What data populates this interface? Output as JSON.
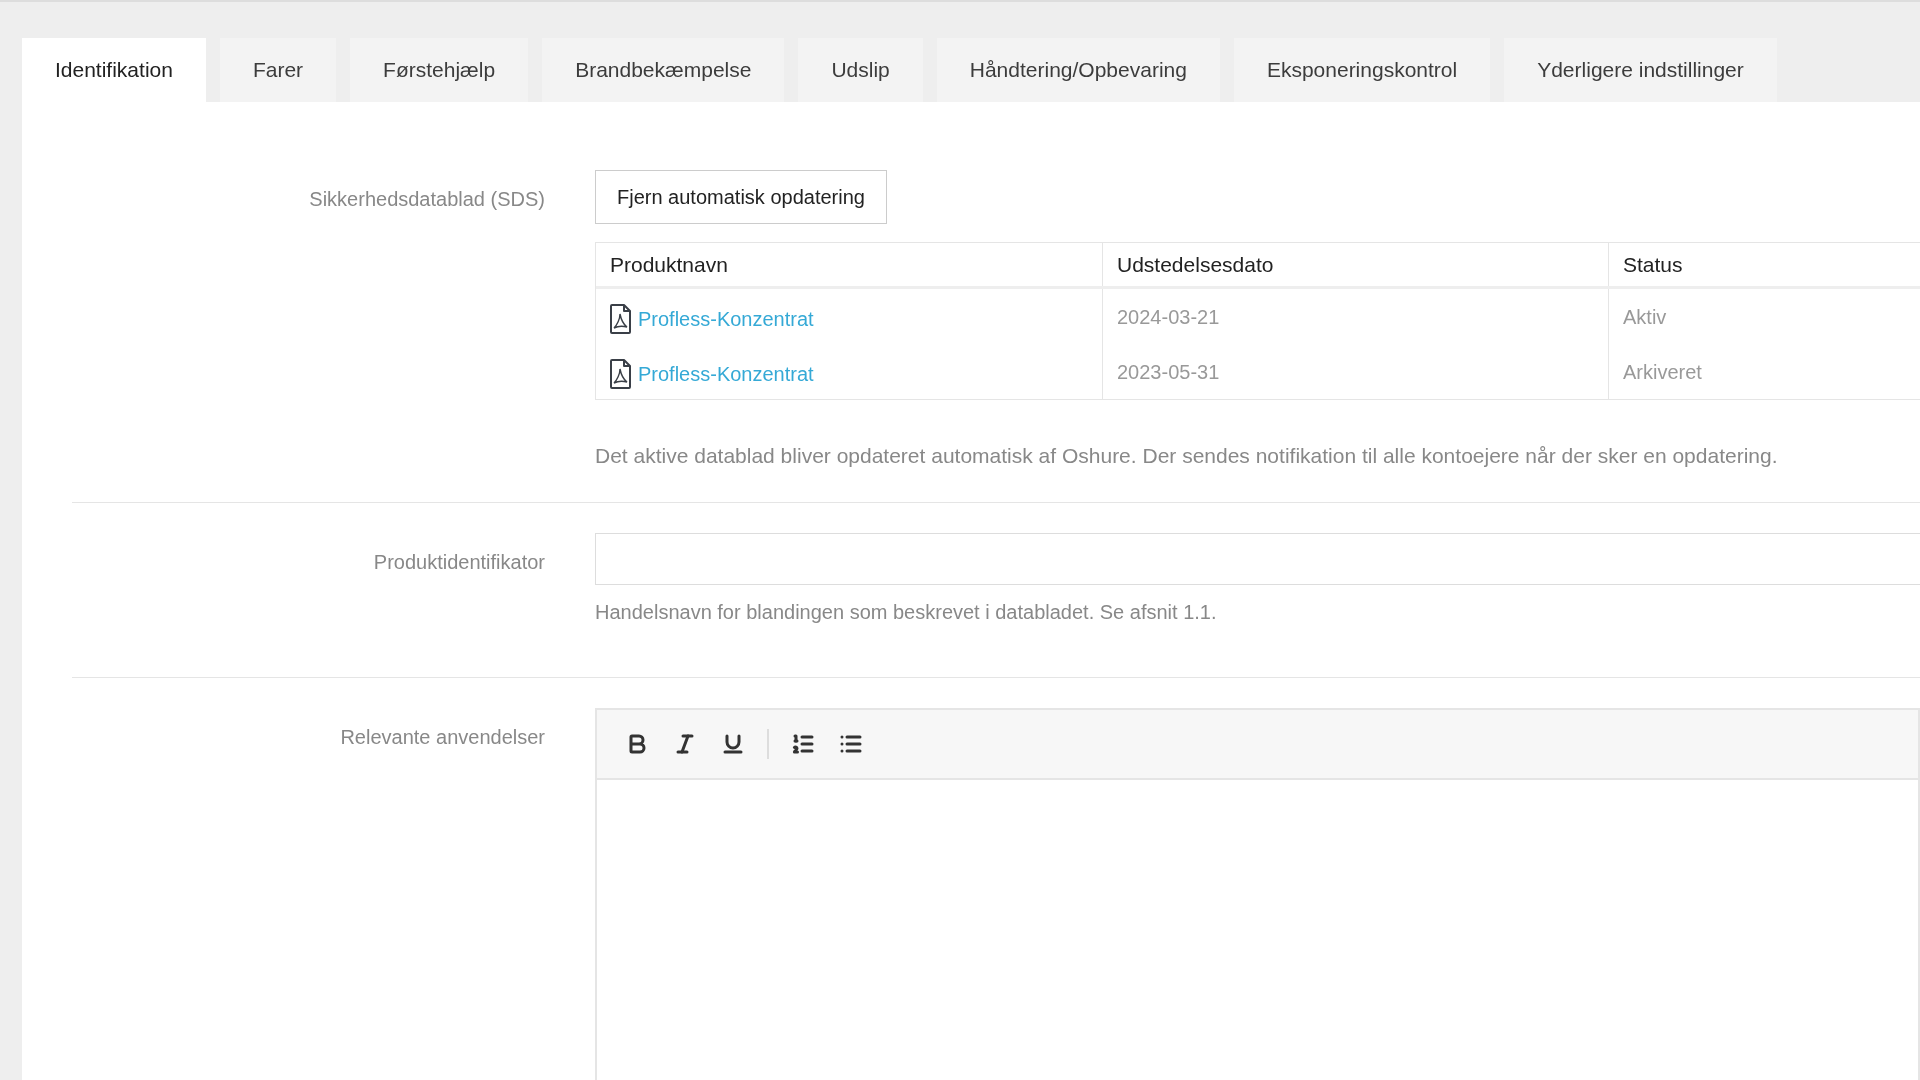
{
  "tabs": [
    {
      "label": "Identifikation",
      "selected": true
    },
    {
      "label": "Farer",
      "selected": false
    },
    {
      "label": "Førstehjælp",
      "selected": false
    },
    {
      "label": "Brandbekæmpelse",
      "selected": false
    },
    {
      "label": "Udslip",
      "selected": false
    },
    {
      "label": "Håndtering/Opbevaring",
      "selected": false
    },
    {
      "label": "Eksponeringskontrol",
      "selected": false
    },
    {
      "label": "Yderligere indstillinger",
      "selected": false
    }
  ],
  "sds": {
    "label": "Sikkerhedsdatablad (SDS)",
    "button": "Fjern automatisk opdatering",
    "table": {
      "columns": [
        "Produktnavn",
        "Udstedelsesdato",
        "Status"
      ],
      "rows": [
        {
          "name": "Profless-Konzentrat",
          "date": "2024-03-21",
          "status": "Aktiv"
        },
        {
          "name": "Profless-Konzentrat",
          "date": "2023-05-31",
          "status": "Arkiveret"
        }
      ]
    },
    "note": "Det aktive datablad bliver opdateret automatisk af Oshure. Der sendes notifikation til alle kontoejere når der sker en opdatering."
  },
  "identifier": {
    "label": "Produktidentifikator",
    "hint": "Handelsnavn for blandingen som beskrevet i databladet. Se afsnit 1.1."
  },
  "uses": {
    "label": "Relevante anvendelser",
    "toolbar": [
      {
        "kind": "bold"
      },
      {
        "kind": "italic"
      },
      {
        "kind": "underline"
      },
      {
        "kind": "divider"
      },
      {
        "kind": "ordered"
      },
      {
        "kind": "bullet"
      }
    ]
  }
}
